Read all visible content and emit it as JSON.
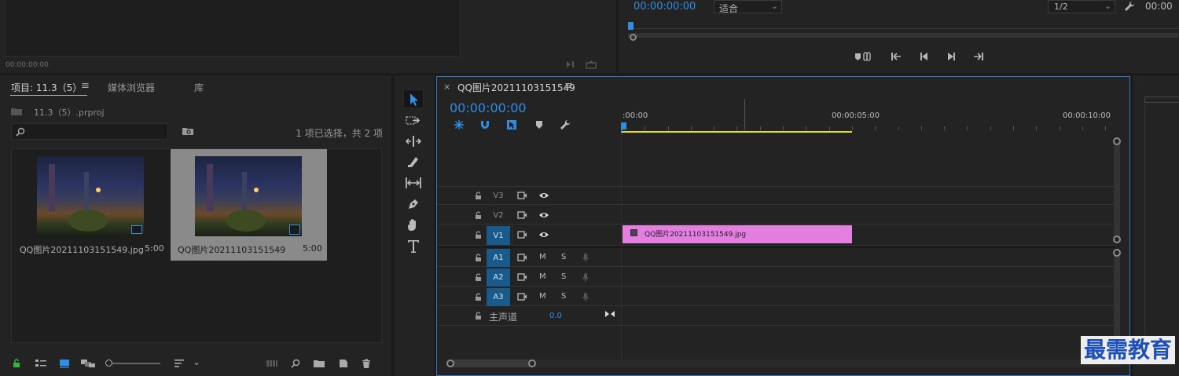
{
  "source_monitor": {
    "timecode": "00:00:00:00"
  },
  "program_monitor": {
    "timecode": "00:00:00:00",
    "zoom_select": "适合",
    "resolution_select": "1/2",
    "right_timecode": "00:00"
  },
  "project_panel": {
    "tabs": [
      {
        "label": "项目: 11.3（5）"
      },
      {
        "label": "媒体浏览器"
      },
      {
        "label": "库"
      }
    ],
    "file_name": "11.3（5）.prproj",
    "search_placeholder": "",
    "selection_status": "1 项已选择，共 2 项",
    "items": [
      {
        "name": "QQ图片20211103151549.jpg",
        "duration": "5:00",
        "selected": false
      },
      {
        "name": "QQ图片20211103151549",
        "duration": "5:00",
        "selected": true
      }
    ]
  },
  "timeline": {
    "sequence_name": "QQ图片20211103151549",
    "timecode": "00:00:00:00",
    "ruler_labels": [
      ":00:00",
      "00:00:05:00",
      "00:00:10:00"
    ],
    "video_tracks": [
      {
        "label": "V3",
        "targeted": false
      },
      {
        "label": "V2",
        "targeted": false
      },
      {
        "label": "V1",
        "targeted": true
      }
    ],
    "audio_tracks": [
      {
        "label": "A1",
        "mute": "M",
        "solo": "S"
      },
      {
        "label": "A2",
        "mute": "M",
        "solo": "S"
      },
      {
        "label": "A3",
        "mute": "M",
        "solo": "S"
      }
    ],
    "master": {
      "label": "主声道",
      "value": "0.0"
    },
    "clip": {
      "name": "QQ图片20211103151549.jpg",
      "color": "#e37fdf"
    }
  },
  "watermark": "最需教育",
  "colors": {
    "accent": "#2f8de4",
    "clip": "#e37fdf",
    "work_area": "#e8e000",
    "target": "#1a5a8a"
  }
}
